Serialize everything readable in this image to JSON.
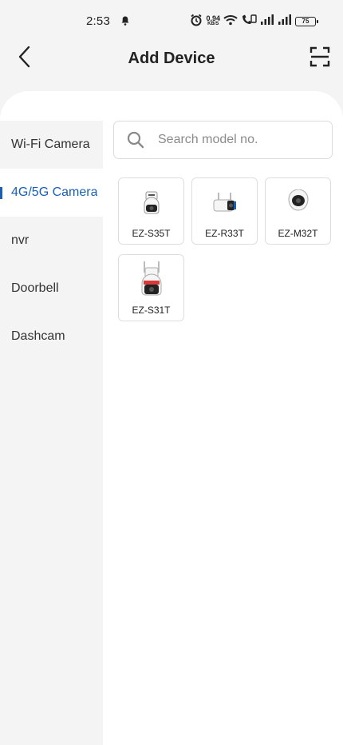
{
  "status_bar": {
    "time": "2:53",
    "net_speed": "0.94",
    "net_unit": "KB/S",
    "battery": "75"
  },
  "header": {
    "title": "Add Device"
  },
  "sidebar": {
    "items": [
      {
        "label": "Wi-Fi Camera",
        "active": false
      },
      {
        "label": "4G/5G Camera",
        "active": true
      },
      {
        "label": "nvr",
        "active": false
      },
      {
        "label": "Doorbell",
        "active": false
      },
      {
        "label": "Dashcam",
        "active": false
      }
    ]
  },
  "search": {
    "placeholder": "Search model no.",
    "value": ""
  },
  "devices": [
    {
      "model": "EZ-S35T",
      "icon": "ptz-camera-small-icon"
    },
    {
      "model": "EZ-R33T",
      "icon": "bullet-camera-icon"
    },
    {
      "model": "EZ-M32T",
      "icon": "dome-camera-icon"
    },
    {
      "model": "EZ-S31T",
      "icon": "ptz-camera-antenna-icon"
    }
  ],
  "colors": {
    "accent": "#1a5fb4",
    "background": "#f4f4f4",
    "panel": "#ffffff"
  }
}
